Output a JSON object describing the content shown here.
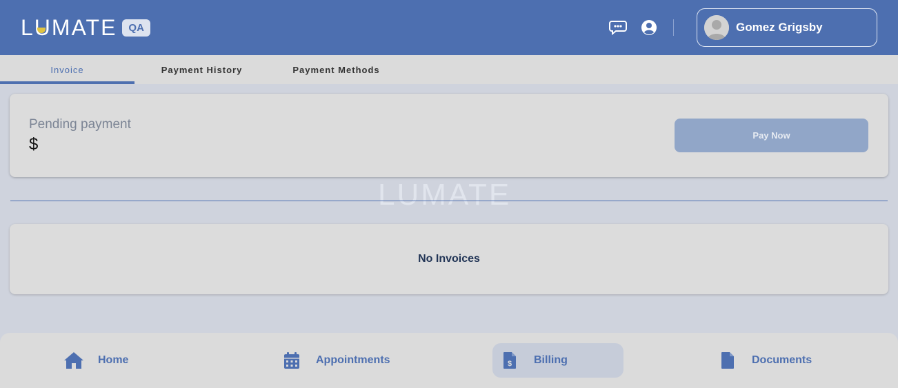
{
  "header": {
    "logo_text": "LUMATE",
    "env_badge": "QA",
    "user_name": "Gomez Grigsby",
    "icons": [
      "chat-icon",
      "user-circle-icon"
    ]
  },
  "tabs": [
    {
      "label": "Invoice",
      "active": true
    },
    {
      "label": "Payment History",
      "active": false
    },
    {
      "label": "Payment Methods",
      "active": false
    }
  ],
  "pending": {
    "label": "Pending payment",
    "amount": "$",
    "pay_button": "Pay Now"
  },
  "watermark": "LUMATE",
  "invoices": {
    "empty_text": "No Invoices"
  },
  "bottom_nav": [
    {
      "label": "Home",
      "icon": "home-icon",
      "active": false
    },
    {
      "label": "Appointments",
      "icon": "calendar-icon",
      "active": false
    },
    {
      "label": "Billing",
      "icon": "billing-icon",
      "active": true
    },
    {
      "label": "Documents",
      "icon": "document-icon",
      "active": false
    }
  ],
  "colors": {
    "brand": "#4d6fb0",
    "logo_accent": "#e0c341",
    "pay_button": "#91a6c8"
  }
}
